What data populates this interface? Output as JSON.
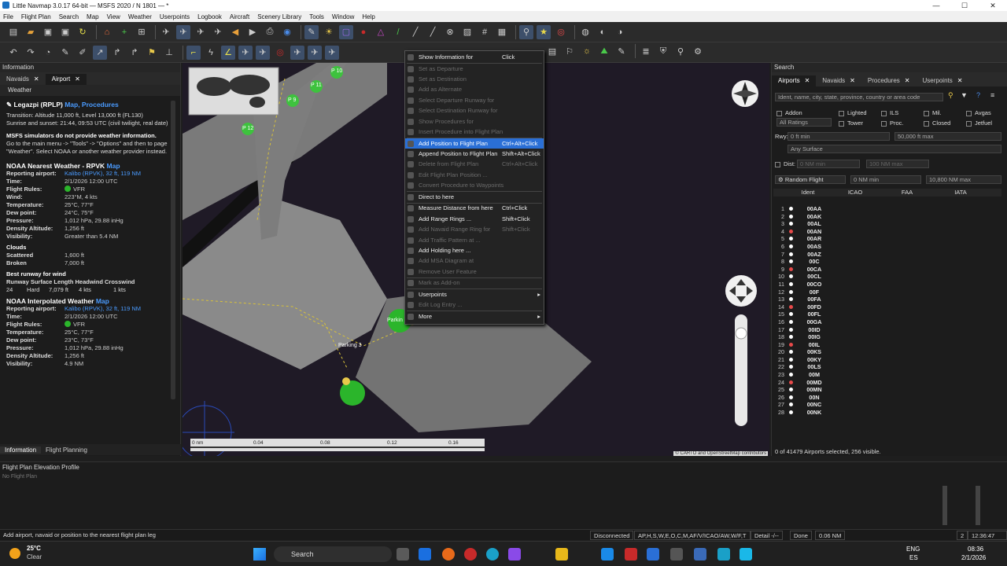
{
  "title": "Little Navmap 3.0.17 64-bit — MSFS 2020 / N 1801 — *",
  "window_controls": [
    "—",
    "☐",
    "✕"
  ],
  "menu": [
    "File",
    "Flight Plan",
    "Search",
    "Map",
    "View",
    "Weather",
    "Userpoints",
    "Logbook",
    "Aircraft",
    "Scenery Library",
    "Tools",
    "Window",
    "Help"
  ],
  "info_panel": {
    "header": "Information",
    "tabs": [
      "Navaids",
      "Airport"
    ],
    "subtab": "Weather",
    "airport_name": "Legazpi (RPLP)",
    "airport_links": "Map, Procedures",
    "transition": "Transition: Altitude 11,000 ft, Level 13,000 ft (FL130)",
    "sun": "Sunrise and sunset: 21:44, 09:53 UTC (civil twilight, real date)",
    "msfs_note": "MSFS simulators do not provide weather information.",
    "note2": "Go to the main menu -> \"Tools\" -> \"Options\" and then to page \"Weather\". Select NOAA or another weather provider instead.",
    "noaa1": {
      "title": "NOAA Nearest Weather - RPVK",
      "link": "Map",
      "rows": [
        [
          "Reporting airport:",
          "Kalibo (RPVK), 32 ft, 119 NM"
        ],
        [
          "Time:",
          "2/1/2026 12:00 UTC"
        ],
        [
          "Flight Rules:",
          "VFR"
        ],
        [
          "Wind:",
          "223°M, 4 kts"
        ],
        [
          "Temperature:",
          "25°C, 77°F"
        ],
        [
          "Dew point:",
          "24°C, 75°F"
        ],
        [
          "Pressure:",
          "1,012 hPa, 29.88 inHg"
        ],
        [
          "Density Altitude:",
          "1,256 ft"
        ],
        [
          "Visibility:",
          "Greater than 5.4 NM"
        ]
      ],
      "clouds_label": "Clouds",
      "clouds": [
        [
          "Scattered",
          "1,600 ft"
        ],
        [
          "Broken",
          "7,000 ft"
        ]
      ],
      "runway_label": "Best runway for wind",
      "runway_hdr": "Runway Surface Length Headwind Crosswind",
      "runway_row": [
        "24",
        "Hard",
        "7,079 ft",
        "4 kts",
        "1 kts"
      ]
    },
    "noaa2": {
      "title": "NOAA Interpolated Weather",
      "link": "Map",
      "rows": [
        [
          "Reporting airport:",
          "Kalibo (RPVK), 32 ft, 119 NM"
        ],
        [
          "Time:",
          "2/1/2026 12:00 UTC"
        ],
        [
          "Flight Rules:",
          "VFR"
        ],
        [
          "Temperature:",
          "25°C, 77°F"
        ],
        [
          "Dew point:",
          "23°C, 73°F"
        ],
        [
          "Pressure:",
          "1,012 hPa, 29.88 inHg"
        ],
        [
          "Density Altitude:",
          "1,256 ft"
        ],
        [
          "Visibility:",
          "4.9 NM"
        ]
      ]
    },
    "bottom_tabs": [
      "Information",
      "Flight Planning"
    ]
  },
  "map": {
    "labels": [
      "P 10",
      "P 11",
      "P 9",
      "P 12",
      "Parking 3",
      "Parkin"
    ],
    "scale": [
      "0 nm",
      "0.04",
      "0.08",
      "0.12",
      "0.16"
    ],
    "attribution": "© CARTO and OpenStreetMap contributors"
  },
  "context_menu": {
    "items": [
      {
        "label": "Show Information for",
        "shortcut": "Click",
        "dis": false
      },
      {
        "label": "Set as Departure",
        "shortcut": "",
        "dis": true
      },
      {
        "label": "Set as Destination",
        "shortcut": "",
        "dis": true
      },
      {
        "label": "Add as Alternate",
        "shortcut": "",
        "dis": true
      },
      {
        "label": "Select Departure Runway for",
        "shortcut": "",
        "dis": true
      },
      {
        "label": "Select Destination Runway for",
        "shortcut": "",
        "dis": true
      },
      {
        "label": "Show Procedures for",
        "shortcut": "",
        "dis": true
      },
      {
        "label": "Insert Procedure into Flight Plan",
        "shortcut": "",
        "dis": true
      },
      {
        "label": "Add Position to Flight Plan",
        "shortcut": "Ctrl+Alt+Click",
        "dis": false,
        "sel": true
      },
      {
        "label": "Append Position to Flight Plan",
        "shortcut": "Shift+Alt+Click",
        "dis": false
      },
      {
        "label": "Delete from Flight Plan",
        "shortcut": "Ctrl+Alt+Click",
        "dis": true
      },
      {
        "label": "Edit Flight Plan Position ...",
        "shortcut": "",
        "dis": true
      },
      {
        "label": "Convert Procedure to Waypoints",
        "shortcut": "",
        "dis": true
      },
      {
        "label": "Direct to here",
        "shortcut": "",
        "dis": false
      },
      {
        "label": "Measure Distance from here",
        "shortcut": "Ctrl+Click",
        "dis": false
      },
      {
        "label": "Add Range Rings ...",
        "shortcut": "Shift+Click",
        "dis": false
      },
      {
        "label": "Add Navaid Range Ring for",
        "shortcut": "Shift+Click",
        "dis": true
      },
      {
        "label": "Add Traffic Pattern at ...",
        "shortcut": "",
        "dis": true
      },
      {
        "label": "Add Holding here ...",
        "shortcut": "",
        "dis": false
      },
      {
        "label": "Add MSA Diagram at",
        "shortcut": "",
        "dis": true
      },
      {
        "label": "Remove User Feature",
        "shortcut": "",
        "dis": true
      },
      {
        "label": "Mark as Add-on",
        "shortcut": "",
        "dis": true
      },
      {
        "label": "Userpoints",
        "shortcut": "",
        "dis": false
      },
      {
        "label": "Edit Log Entry ...",
        "shortcut": "",
        "dis": true
      },
      {
        "label": "More",
        "shortcut": "",
        "dis": false
      }
    ]
  },
  "search_panel": {
    "header": "Search",
    "tabs": [
      "Airports",
      "Navaids",
      "Procedures",
      "Userpoints"
    ],
    "search_placeholder": "Ident, name, city, state, province, country or area code",
    "checks": [
      "Addon",
      "Lighted",
      "ILS",
      "Mil.",
      "Avgas",
      "Tower",
      "Proc.",
      "Closed",
      "Jetfuel"
    ],
    "ratings": "All Ratings",
    "rwy_label": "Rwy:",
    "rwy_min": "0 ft min",
    "rwy_max": "50,000 ft max",
    "surface": "Any Surface",
    "dist_label": "Dist:",
    "dist_min": "0 NM min",
    "dist_max": "100 NM max",
    "random_flight": "Random Flight",
    "rf_min": "0 NM min",
    "rf_max": "10,800 NM max",
    "columns": [
      "Ident",
      "ICAO",
      "FAA",
      "IATA"
    ],
    "idents": [
      "00AA",
      "00AK",
      "00AL",
      "00AN",
      "00AR",
      "00AS",
      "00AZ",
      "00C",
      "00CA",
      "00CL",
      "00CO",
      "00F",
      "00FA",
      "00FD",
      "00FL",
      "00GA",
      "00ID",
      "00IG",
      "00IL",
      "00KS",
      "00KY",
      "00LS",
      "00M",
      "00MD",
      "00MN",
      "00N",
      "00NC",
      "00NK"
    ],
    "status": "0 of 41479 Airports selected, 256 visible."
  },
  "elevation": {
    "header": "Flight Plan Elevation Profile",
    "empty": "No Flight Plan"
  },
  "statusbar": {
    "hint": "Add airport, navaid or position to the nearest flight plan leg",
    "conn": "Disconnected",
    "codes": "AP,H,S,W,E,O,C,M,AF/V/ICAO/AW,W/F,T",
    "detail": "Detail -/--",
    "done": "Done",
    "dist": "0.06 NM",
    "zoom": "2",
    "time": "12:36:47 UTC"
  },
  "taskbar": {
    "temp": "25°C",
    "weather": "Clear",
    "search": "Search",
    "lang": "ENG",
    "region": "ES",
    "clock": "08:36",
    "date": "2/1/2026"
  }
}
